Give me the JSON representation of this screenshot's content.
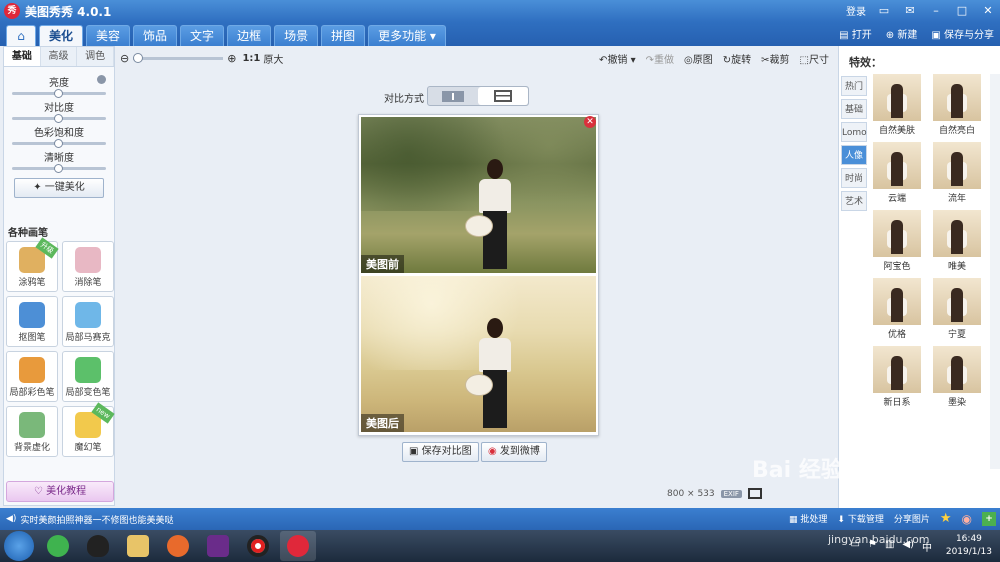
{
  "app": {
    "title": "美图秀秀 4.0.1",
    "logo": "秀",
    "login": "登录"
  },
  "menu": {
    "tabs": [
      "美化",
      "美容",
      "饰品",
      "文字",
      "边框",
      "场景",
      "拼图",
      "更多功能 ▾"
    ],
    "open": "打开",
    "new": "新建",
    "save_share": "保存与分享"
  },
  "left": {
    "subtabs": [
      "基础",
      "高级",
      "调色"
    ],
    "sliders": [
      {
        "label": "亮度",
        "value": 0.5
      },
      {
        "label": "对比度",
        "value": 0.5
      },
      {
        "label": "色彩饱和度",
        "value": 0.5
      },
      {
        "label": "清晰度",
        "value": 0.5
      }
    ],
    "one_click": "一键美化",
    "brush_title": "各种画笔",
    "brushes": [
      {
        "label": "涂鸦笔",
        "color": "#e0b060",
        "badge": "升级"
      },
      {
        "label": "消除笔",
        "color": "#e8b8c4",
        "badge": ""
      },
      {
        "label": "抠图笔",
        "color": "#4d8fd6",
        "badge": ""
      },
      {
        "label": "局部马赛克",
        "color": "#6fb7e8",
        "badge": ""
      },
      {
        "label": "局部彩色笔",
        "color": "#e89a3c",
        "badge": ""
      },
      {
        "label": "局部变色笔",
        "color": "#5cc06a",
        "badge": ""
      },
      {
        "label": "背景虚化",
        "color": "#7ab87a",
        "badge": ""
      },
      {
        "label": "魔幻笔",
        "color": "#f2c94c",
        "badge": "new"
      }
    ],
    "tutorial": "美化教程"
  },
  "toolbar": {
    "zoom_ratio": "1:1",
    "zoom_label": "原大",
    "undo": "撤销",
    "redo": "重做",
    "original": "原图",
    "rotate": "旋转",
    "crop": "裁剪",
    "size": "尺寸"
  },
  "compare": {
    "label": "对比方式",
    "before": "美图前",
    "after": "美图后",
    "save_btn": "保存对比图",
    "weibo_btn": "发到微博",
    "dimensions": "800 × 533",
    "exif": "EXIF"
  },
  "right": {
    "title": "特效：",
    "categories": [
      "热门",
      "基础",
      "Lomo",
      "人像",
      "时尚",
      "艺术"
    ],
    "active_category": 3,
    "effects": [
      "自然美肤",
      "自然亮白",
      "云端",
      "流年",
      "阿宝色",
      "唯美",
      "优格",
      "宁夏",
      "新日系",
      "墨染"
    ]
  },
  "bottom": {
    "ad": "实时美颜拍照神器一不修图也能美美哒",
    "batch": "批处理",
    "download": "下载管理",
    "share": "分享图片"
  },
  "taskbar": {
    "time": "16:49",
    "date": "2019/1/13"
  },
  "watermark": {
    "brand": "Bai 经验",
    "url": "jingyan.baidu.com"
  }
}
